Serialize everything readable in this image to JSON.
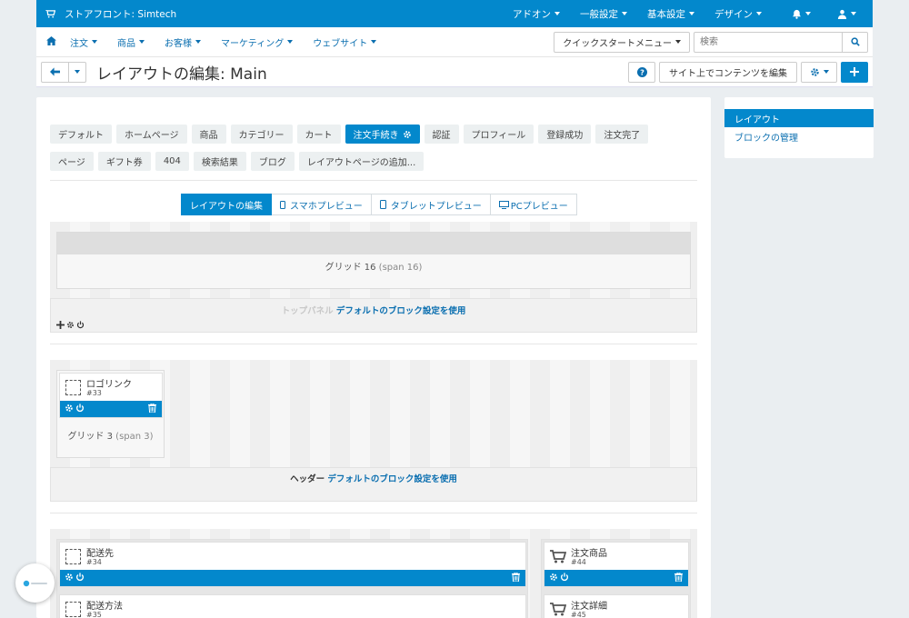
{
  "topbar": {
    "brand": "ストアフロント: Simtech",
    "menus": [
      "アドオン",
      "一般設定",
      "基本設定",
      "デザイン"
    ]
  },
  "navbar": {
    "items": [
      "注文",
      "商品",
      "お客様",
      "マーケティング",
      "ウェブサイト"
    ],
    "quickstart": "クイックスタートメニュー",
    "search_placeholder": "検索"
  },
  "titlebar": {
    "title": "レイアウトの編集: Main",
    "edit_button": "サイト上でコンテンツを編集"
  },
  "layout_tabs": {
    "row1": [
      "デフォルト",
      "ホームページ",
      "商品",
      "カテゴリー",
      "カート",
      "注文手続き",
      "認証",
      "プロフィール",
      "登録成功",
      "注文完了",
      "ページ"
    ],
    "row2": [
      "ギフト券",
      "404",
      "検索結果",
      "ブログ",
      "レイアウトページの追加..."
    ],
    "active": "注文手続き"
  },
  "view_tabs": [
    "レイアウトの編集",
    "スマホプレビュー",
    "タブレットプレビュー",
    "PCプレビュー"
  ],
  "containers": {
    "top": {
      "grid_label": "グリッド 16",
      "grid_span": "(span 16)",
      "name": "トップパネル",
      "link": "デフォルトのブロック設定を使用"
    },
    "header": {
      "grid_label": "グリッド 3",
      "grid_span": "(span 3)",
      "name": "ヘッダー",
      "link": "デフォルトのブロック設定を使用",
      "block": {
        "name": "ロゴリンク",
        "id": "#33"
      }
    },
    "content": {
      "blocks_left": [
        {
          "name": "配送先",
          "id": "#34"
        },
        {
          "name": "配送方法",
          "id": "#35"
        }
      ],
      "blocks_right": [
        {
          "name": "注文商品",
          "id": "#44"
        },
        {
          "name": "注文詳細",
          "id": "#45"
        }
      ]
    }
  },
  "sidebar": {
    "items": [
      "レイアウト",
      "ブロックの管理"
    ],
    "active": "レイアウト"
  },
  "colors": {
    "primary": "#0388cc",
    "link": "#0b6fb0"
  }
}
